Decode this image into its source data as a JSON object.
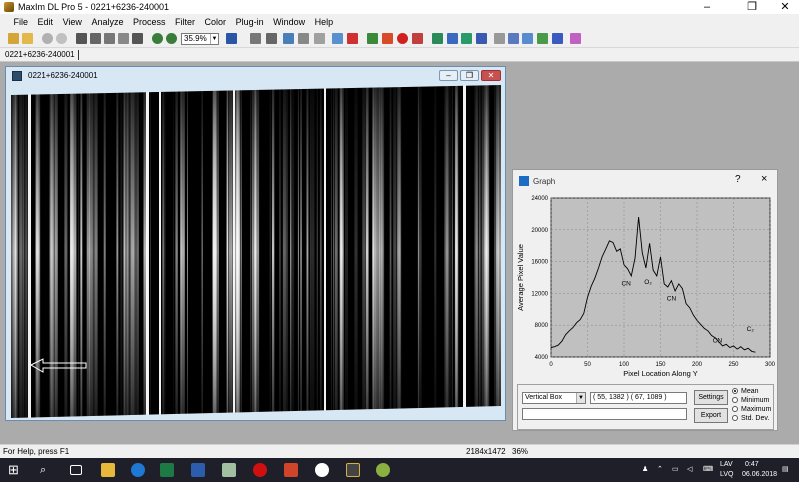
{
  "window": {
    "title": "MaxIm DL Pro 5 - 0221+6236-240001"
  },
  "menu": [
    "File",
    "Edit",
    "View",
    "Analyze",
    "Process",
    "Filter",
    "Color",
    "Plug-in",
    "Window",
    "Help"
  ],
  "toolbar": {
    "zoom_value": "35.9%"
  },
  "doc_tab": "0221+6236-240001",
  "image_window": {
    "title": "0221+6236-240001"
  },
  "graph": {
    "title": "Graph",
    "mode": "Vertical Box",
    "coords": "( 55, 1382 ) ( 67, 1089 )",
    "settings_label": "Settings",
    "export_label": "Export",
    "options": [
      "Mean",
      "Minimum",
      "Maximum",
      "Std. Dev."
    ],
    "selected_option": "Mean",
    "help_glyph": "?",
    "close_glyph": "×"
  },
  "chart_data": {
    "type": "line",
    "xlabel": "Pixel Location Along Y",
    "ylabel": "Average Pixel Value",
    "xlim": [
      0,
      300
    ],
    "ylim": [
      4000,
      24000
    ],
    "xticks": [
      0,
      50,
      100,
      150,
      200,
      250,
      300
    ],
    "yticks": [
      4000,
      8000,
      12000,
      16000,
      20000,
      24000
    ],
    "grid": true,
    "background": "#c0c0c0",
    "line_color": "#000000",
    "series": [
      {
        "x": [
          0,
          5,
          10,
          15,
          20,
          25,
          30,
          35,
          40,
          45,
          50,
          55,
          60,
          65,
          70,
          75,
          80,
          85,
          90,
          95,
          100,
          105,
          110,
          115,
          120,
          125,
          130,
          135,
          140,
          145,
          150,
          155,
          160,
          165,
          170,
          175,
          180,
          185,
          190,
          195,
          200,
          205,
          210,
          215,
          220,
          225,
          230,
          235,
          240,
          245,
          250,
          255,
          260,
          265,
          270,
          275,
          280
        ],
        "y": [
          5200,
          5300,
          5500,
          6000,
          6800,
          7300,
          7700,
          8300,
          8700,
          9500,
          11500,
          12900,
          13900,
          15200,
          16600,
          17600,
          18600,
          18400,
          17300,
          17600,
          15600,
          15100,
          14200,
          16400,
          21600,
          17100,
          15200,
          18300,
          14900,
          14200,
          16600,
          13200,
          12800,
          13600,
          12300,
          13200,
          12600,
          10700,
          10200,
          9300,
          8600,
          8100,
          7600,
          7300,
          6700,
          6400,
          5900,
          5400,
          5600,
          5200,
          5400,
          5000,
          5300,
          4900,
          5100,
          4700,
          4600
        ]
      }
    ],
    "annotations": [
      {
        "text": "CN",
        "x": 103,
        "y": 13000
      },
      {
        "text": "O₂",
        "x": 133,
        "y": 13200
      },
      {
        "text": "CN",
        "x": 165,
        "y": 11100
      },
      {
        "text": "CN",
        "x": 228,
        "y": 5800
      },
      {
        "text": "C₂",
        "x": 273,
        "y": 7300
      }
    ]
  },
  "status": {
    "help": "For Help, press F1",
    "dims": "2184x1472",
    "zoom": "36%"
  },
  "taskbar": {
    "lang": "LAV",
    "lang2": "LVQ",
    "time": "0:47",
    "date": "06.06.2018"
  }
}
